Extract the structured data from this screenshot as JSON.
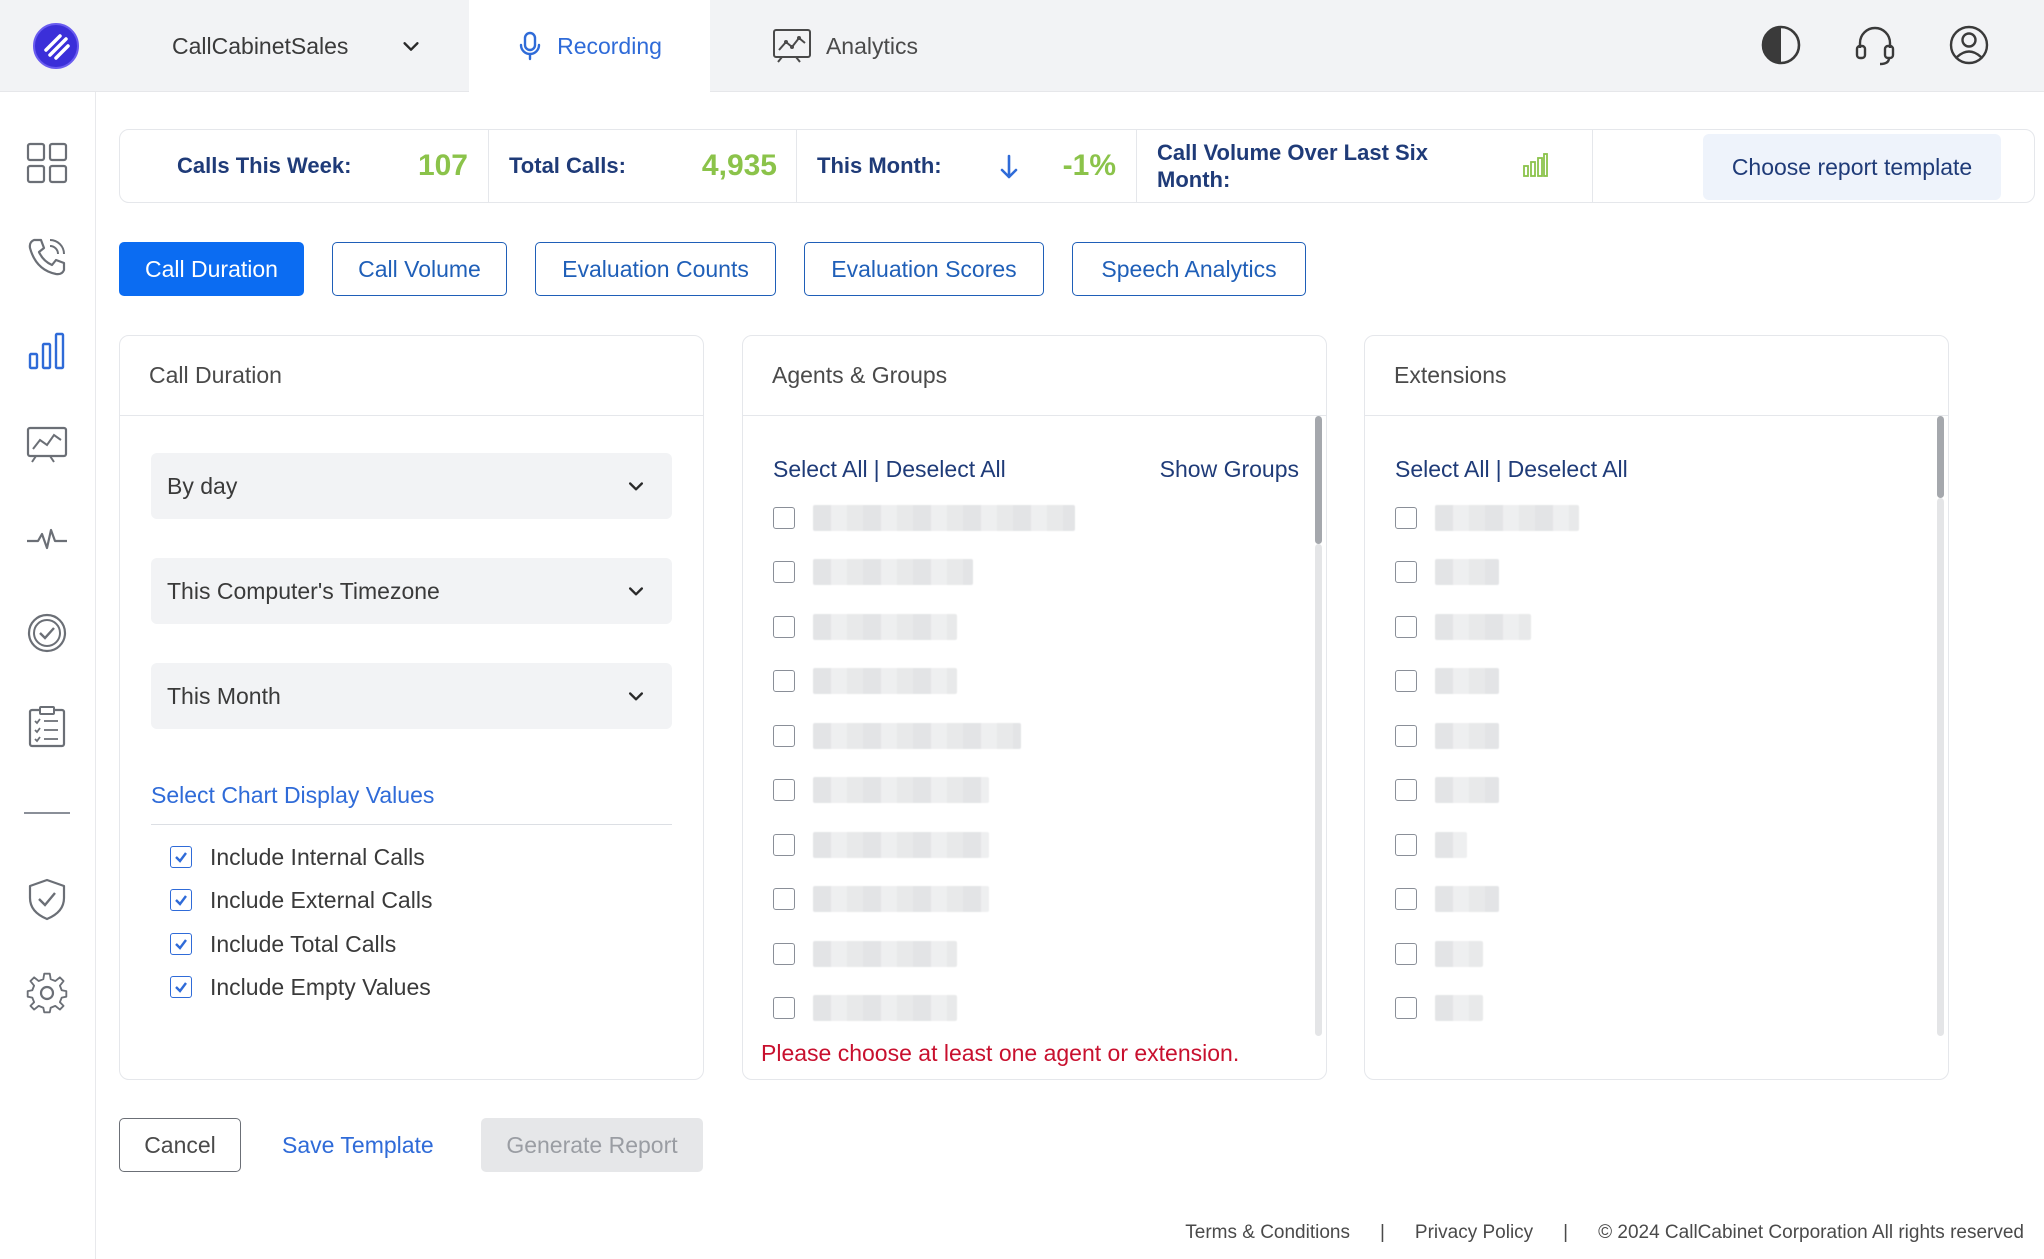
{
  "header": {
    "account_name": "CallCabinetSales",
    "tabs": [
      {
        "label": "Recording",
        "active": true
      },
      {
        "label": "Analytics",
        "active": false
      }
    ],
    "right_icons": [
      "theme-contrast-icon",
      "support-headset-icon",
      "user-profile-icon"
    ]
  },
  "sidebar": {
    "items": [
      {
        "name": "dashboard-icon"
      },
      {
        "name": "calls-icon"
      },
      {
        "name": "reports-icon",
        "active": true
      },
      {
        "name": "analytics-icon"
      },
      {
        "name": "pulse-icon"
      },
      {
        "name": "evaluation-icon"
      },
      {
        "name": "checklist-icon"
      },
      {
        "name": "compliance-shield-icon"
      },
      {
        "name": "settings-icon"
      }
    ]
  },
  "stats": {
    "calls_this_week_label": "Calls This Week:",
    "calls_this_week_value": "107",
    "total_calls_label": "Total Calls:",
    "total_calls_value": "4,935",
    "this_month_label": "This Month:",
    "this_month_value": "-1%",
    "call_volume_label": "Call Volume Over Last Six Month:",
    "choose_template": "Choose report template"
  },
  "report_types": [
    {
      "label": "Call Duration",
      "active": true
    },
    {
      "label": "Call Volume",
      "active": false
    },
    {
      "label": "Evaluation Counts",
      "active": false
    },
    {
      "label": "Evaluation Scores",
      "active": false
    },
    {
      "label": "Speech Analytics",
      "active": false
    }
  ],
  "call_duration_panel": {
    "title": "Call Duration",
    "grouping": "By day",
    "timezone": "This Computer's Timezone",
    "period": "This Month",
    "chart_values_link": "Select Chart Display Values",
    "options": [
      {
        "label": "Include Internal Calls",
        "checked": true
      },
      {
        "label": "Include External Calls",
        "checked": true
      },
      {
        "label": "Include Total Calls",
        "checked": true
      },
      {
        "label": "Include Empty Values",
        "checked": true
      }
    ]
  },
  "agents_panel": {
    "title": "Agents & Groups",
    "select_all": "Select All",
    "deselect_all": "Deselect All",
    "show_groups": "Show Groups",
    "error": "Please choose at least one agent or extension."
  },
  "extensions_panel": {
    "title": "Extensions",
    "select_all": "Select All",
    "deselect_all": "Deselect All"
  },
  "actions": {
    "cancel": "Cancel",
    "save_template": "Save Template",
    "generate_report": "Generate Report"
  },
  "footer": {
    "terms": "Terms & Conditions",
    "privacy": "Privacy Policy",
    "copyright": "© 2024 CallCabinet Corporation All rights reserved"
  },
  "colors": {
    "accent": "#0b6cf2",
    "navy": "#1f3b78",
    "stat_green": "#8bc34a",
    "error_red": "#c8102e"
  }
}
